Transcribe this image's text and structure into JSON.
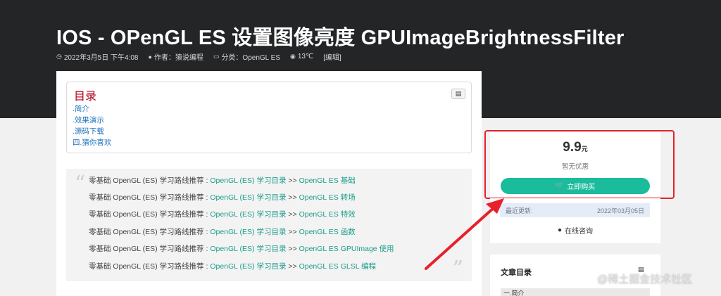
{
  "article": {
    "title": "IOS  -  OPenGL ES 设置图像亮度 GPUImageBrightnessFilter",
    "meta": {
      "date": "2022年3月5日 下午4:08",
      "author": "作者：猿说编程",
      "category": "分类：OpenGL ES",
      "temperature": "13℃",
      "edit": "[编辑]"
    }
  },
  "toc": {
    "title": "目录",
    "items": [
      ".简介",
      ".效果演示",
      ".源码下载",
      "四.猜你喜欢"
    ]
  },
  "quote": {
    "open_mark": "“",
    "close_mark": "”",
    "prefix": "零基础 OpenGL (ES) 学习路线推荐 : ",
    "link_main": "OpenGL (ES) 学习目录",
    "separator": " >> ",
    "lines": [
      "OpenGL ES 基础",
      "OpenGL ES 转场",
      "OpenGL ES 特效",
      "OpenGL ES 函数",
      "OpenGL ES GPUImage 使用",
      "OpenGL ES GLSL 编程"
    ]
  },
  "sidebar": {
    "price_value": "9.9",
    "price_unit": "元",
    "discount": "暂无优惠",
    "buy_label": "立即购买",
    "update_label": "最近更新:",
    "update_date": "2022年03月05日",
    "consult_label": "在线咨询",
    "article_toc_title": "文章目录",
    "article_toc_first": "一.简介"
  },
  "watermark": "@稀土掘金技术社区",
  "colors": {
    "header_bg": "#232527",
    "accent_green": "#1abc9c",
    "link_teal": "#1a9c8a",
    "toc_red": "#b1001e",
    "annotation_red": "#e8202a"
  },
  "icons": [
    "clock-icon",
    "user-icon",
    "folder-icon",
    "eye-icon",
    "toc-toggle-icon",
    "cart-icon",
    "chat-icon",
    "list-icon"
  ]
}
